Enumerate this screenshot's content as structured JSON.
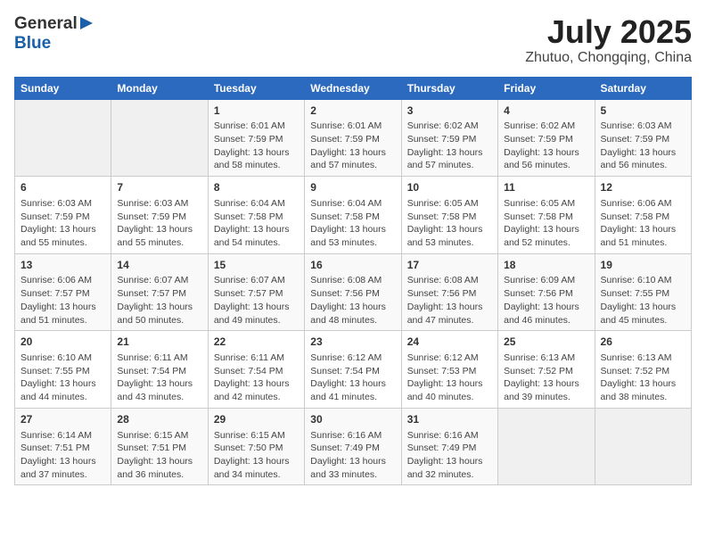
{
  "header": {
    "logo_line1": "General",
    "logo_line2": "Blue",
    "month": "July 2025",
    "location": "Zhutuo, Chongqing, China"
  },
  "days_of_week": [
    "Sunday",
    "Monday",
    "Tuesday",
    "Wednesday",
    "Thursday",
    "Friday",
    "Saturday"
  ],
  "weeks": [
    [
      {
        "day": "",
        "info": ""
      },
      {
        "day": "",
        "info": ""
      },
      {
        "day": "1",
        "info": "Sunrise: 6:01 AM\nSunset: 7:59 PM\nDaylight: 13 hours and 58 minutes."
      },
      {
        "day": "2",
        "info": "Sunrise: 6:01 AM\nSunset: 7:59 PM\nDaylight: 13 hours and 57 minutes."
      },
      {
        "day": "3",
        "info": "Sunrise: 6:02 AM\nSunset: 7:59 PM\nDaylight: 13 hours and 57 minutes."
      },
      {
        "day": "4",
        "info": "Sunrise: 6:02 AM\nSunset: 7:59 PM\nDaylight: 13 hours and 56 minutes."
      },
      {
        "day": "5",
        "info": "Sunrise: 6:03 AM\nSunset: 7:59 PM\nDaylight: 13 hours and 56 minutes."
      }
    ],
    [
      {
        "day": "6",
        "info": "Sunrise: 6:03 AM\nSunset: 7:59 PM\nDaylight: 13 hours and 55 minutes."
      },
      {
        "day": "7",
        "info": "Sunrise: 6:03 AM\nSunset: 7:59 PM\nDaylight: 13 hours and 55 minutes."
      },
      {
        "day": "8",
        "info": "Sunrise: 6:04 AM\nSunset: 7:58 PM\nDaylight: 13 hours and 54 minutes."
      },
      {
        "day": "9",
        "info": "Sunrise: 6:04 AM\nSunset: 7:58 PM\nDaylight: 13 hours and 53 minutes."
      },
      {
        "day": "10",
        "info": "Sunrise: 6:05 AM\nSunset: 7:58 PM\nDaylight: 13 hours and 53 minutes."
      },
      {
        "day": "11",
        "info": "Sunrise: 6:05 AM\nSunset: 7:58 PM\nDaylight: 13 hours and 52 minutes."
      },
      {
        "day": "12",
        "info": "Sunrise: 6:06 AM\nSunset: 7:58 PM\nDaylight: 13 hours and 51 minutes."
      }
    ],
    [
      {
        "day": "13",
        "info": "Sunrise: 6:06 AM\nSunset: 7:57 PM\nDaylight: 13 hours and 51 minutes."
      },
      {
        "day": "14",
        "info": "Sunrise: 6:07 AM\nSunset: 7:57 PM\nDaylight: 13 hours and 50 minutes."
      },
      {
        "day": "15",
        "info": "Sunrise: 6:07 AM\nSunset: 7:57 PM\nDaylight: 13 hours and 49 minutes."
      },
      {
        "day": "16",
        "info": "Sunrise: 6:08 AM\nSunset: 7:56 PM\nDaylight: 13 hours and 48 minutes."
      },
      {
        "day": "17",
        "info": "Sunrise: 6:08 AM\nSunset: 7:56 PM\nDaylight: 13 hours and 47 minutes."
      },
      {
        "day": "18",
        "info": "Sunrise: 6:09 AM\nSunset: 7:56 PM\nDaylight: 13 hours and 46 minutes."
      },
      {
        "day": "19",
        "info": "Sunrise: 6:10 AM\nSunset: 7:55 PM\nDaylight: 13 hours and 45 minutes."
      }
    ],
    [
      {
        "day": "20",
        "info": "Sunrise: 6:10 AM\nSunset: 7:55 PM\nDaylight: 13 hours and 44 minutes."
      },
      {
        "day": "21",
        "info": "Sunrise: 6:11 AM\nSunset: 7:54 PM\nDaylight: 13 hours and 43 minutes."
      },
      {
        "day": "22",
        "info": "Sunrise: 6:11 AM\nSunset: 7:54 PM\nDaylight: 13 hours and 42 minutes."
      },
      {
        "day": "23",
        "info": "Sunrise: 6:12 AM\nSunset: 7:54 PM\nDaylight: 13 hours and 41 minutes."
      },
      {
        "day": "24",
        "info": "Sunrise: 6:12 AM\nSunset: 7:53 PM\nDaylight: 13 hours and 40 minutes."
      },
      {
        "day": "25",
        "info": "Sunrise: 6:13 AM\nSunset: 7:52 PM\nDaylight: 13 hours and 39 minutes."
      },
      {
        "day": "26",
        "info": "Sunrise: 6:13 AM\nSunset: 7:52 PM\nDaylight: 13 hours and 38 minutes."
      }
    ],
    [
      {
        "day": "27",
        "info": "Sunrise: 6:14 AM\nSunset: 7:51 PM\nDaylight: 13 hours and 37 minutes."
      },
      {
        "day": "28",
        "info": "Sunrise: 6:15 AM\nSunset: 7:51 PM\nDaylight: 13 hours and 36 minutes."
      },
      {
        "day": "29",
        "info": "Sunrise: 6:15 AM\nSunset: 7:50 PM\nDaylight: 13 hours and 34 minutes."
      },
      {
        "day": "30",
        "info": "Sunrise: 6:16 AM\nSunset: 7:49 PM\nDaylight: 13 hours and 33 minutes."
      },
      {
        "day": "31",
        "info": "Sunrise: 6:16 AM\nSunset: 7:49 PM\nDaylight: 13 hours and 32 minutes."
      },
      {
        "day": "",
        "info": ""
      },
      {
        "day": "",
        "info": ""
      }
    ]
  ]
}
